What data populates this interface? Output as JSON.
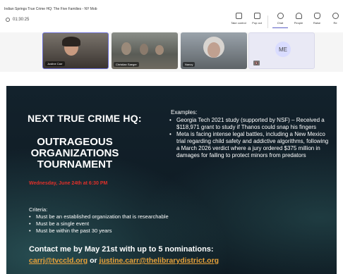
{
  "window": {
    "title": "Indian Springs True Crime HQ: The Five Families - NY Mob"
  },
  "toolbar": {
    "timer": "01:30:25",
    "tools": [
      {
        "icon": "whiteboard-icon",
        "label": "Take control"
      },
      {
        "icon": "popout-icon",
        "label": "Pop out"
      },
      {
        "icon": "chat-icon",
        "label": "Chat"
      },
      {
        "icon": "people-icon",
        "label": "People"
      },
      {
        "icon": "raise-hand-icon",
        "label": "Raise"
      },
      {
        "icon": "react-icon",
        "label": "Re"
      }
    ]
  },
  "participants": [
    {
      "name": "Justine Carr"
    },
    {
      "name": "Christian Saeger"
    },
    {
      "name": "Nancy"
    },
    {
      "initials": "ME"
    }
  ],
  "slide": {
    "heading": "NEXT TRUE CRIME HQ:",
    "tournament_lines": [
      "OUTRAGEOUS",
      "ORGANIZATIONS",
      "TOURNAMENT"
    ],
    "date": "Wednesday, June 24th at 6:30 PM",
    "examples_title": "Examples:",
    "examples": [
      "Georgia Tech 2021 study (supported by NSF) – Received a $118,971 grant to study if Thanos could snap his fingers",
      "Meta is facing intense legal battles, including a New Mexico trial regarding child safety and addictive algorithms, following a March 2026 verdict where a jury ordered $375 million in damages for failing to protect minors from predators"
    ],
    "criteria_title": "Criteria:",
    "criteria": [
      "Must be an established organization that is researchable",
      "Must be a single event",
      "Must be within the past 30 years"
    ],
    "contact": "Contact me by May 21st with up to 5 nominations:",
    "email1": "carrj@tvccld.org",
    "email_or": " or ",
    "email2": "justine.carr@thelibrarydistrict.org"
  },
  "colors": {
    "accent": "#5b5fc7",
    "slide_bg": "#0f1c26",
    "date_red": "#e0302a",
    "link": "#e8a23a"
  }
}
